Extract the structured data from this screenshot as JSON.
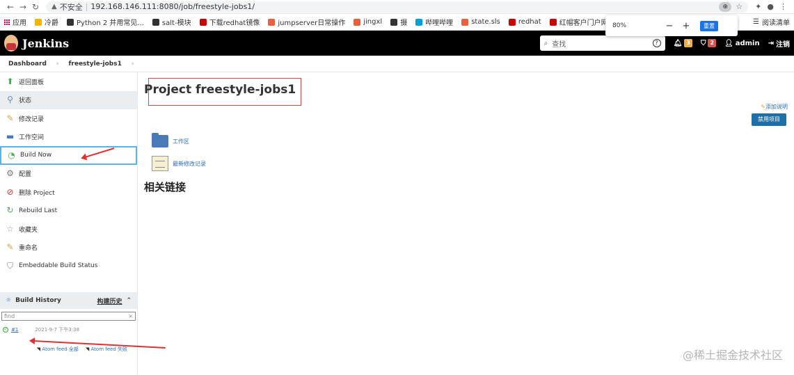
{
  "browser": {
    "insecure_label": "不安全",
    "url": "192.168.146.111:8080/job/freestyle-jobs1/",
    "zoom_value": "80%",
    "zoom_minus": "−",
    "zoom_plus": "+",
    "zoom_reset": "重置",
    "bookmarks": [
      {
        "label": "应用",
        "color": "#d04040"
      },
      {
        "label": "冷爵",
        "color": "#f4b400"
      },
      {
        "label": "Python 2 并用常见...",
        "color": "#333333"
      },
      {
        "label": "salt-模块",
        "color": "#333333"
      },
      {
        "label": "下载redhat镜像",
        "color": "#cc0000"
      },
      {
        "label": "jumpserver日常操作",
        "color": "#e8603c"
      },
      {
        "label": "jingxl",
        "color": "#e8603c"
      },
      {
        "label": "摄",
        "color": "#333333"
      },
      {
        "label": "哔哩哔哩",
        "color": "#00a1d6"
      },
      {
        "label": "state.sls",
        "color": "#e8603c"
      },
      {
        "label": "redhat",
        "color": "#cc0000"
      },
      {
        "label": "红帽客户门户网站",
        "color": "#cc0000"
      }
    ],
    "reading_list": "阅读清单"
  },
  "header": {
    "title": "Jenkins",
    "search_placeholder": "查找",
    "notifications_count": "3",
    "alerts_count": "2",
    "user": "admin",
    "logout": "注销"
  },
  "breadcrumb": {
    "items": [
      "Dashboard",
      "freestyle-jobs1"
    ],
    "sep": "›"
  },
  "sidebar": {
    "items": [
      {
        "label": "返回面板",
        "icon": "up-arrow-icon",
        "color": "#3cb043"
      },
      {
        "label": "状态",
        "icon": "search-icon",
        "color": "#6a8caf"
      },
      {
        "label": "修改记录",
        "icon": "notepad-icon",
        "color": "#c9a74a"
      },
      {
        "label": "工作空间",
        "icon": "folder-icon",
        "color": "#4a7ab8"
      },
      {
        "label": "Build Now",
        "icon": "build-clock-icon",
        "color": "#4caf50"
      },
      {
        "label": "配置",
        "icon": "gear-icon",
        "color": "#777777"
      },
      {
        "label": "删除 Project",
        "icon": "no-entry-icon",
        "color": "#d9302c"
      },
      {
        "label": "Rebuild Last",
        "icon": "rebuild-icon",
        "color": "#4caf50"
      },
      {
        "label": "收藏夹",
        "icon": "star-icon",
        "color": "#999999"
      },
      {
        "label": "重命名",
        "icon": "rename-icon",
        "color": "#c9a74a"
      },
      {
        "label": "Embeddable Build Status",
        "icon": "shield-icon",
        "color": "#888888"
      }
    ],
    "history": {
      "title": "Build History",
      "trend": "构建历史",
      "find_placeholder": "find",
      "clear": "×",
      "builds": [
        {
          "number": "#1",
          "date": "2021-9-7 下午3:38"
        }
      ],
      "feed_all": "Atom feed 全部",
      "feed_fail": "Atom feed 失败"
    }
  },
  "content": {
    "title": "Project freestyle-jobs1",
    "add_description": "添加说明",
    "disable_button": "禁用项目",
    "workspace_link": "工作区",
    "changes_link": "最新修改记录",
    "related_links": "相关链接"
  },
  "watermark": "@稀土掘金技术社区",
  "colors": {
    "accent_blue": "#1e6ea7",
    "annotation_red": "#e03030",
    "header_bg": "#000000"
  }
}
